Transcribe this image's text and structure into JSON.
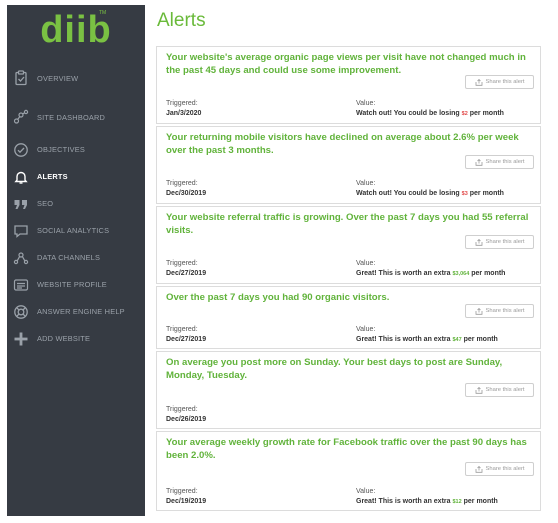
{
  "app": {
    "logo": "diib",
    "logo_mark": "TM"
  },
  "page": {
    "title": "Alerts"
  },
  "sidebar": {
    "items": [
      {
        "label": "OVERVIEW",
        "icon": "clipboard-check-icon",
        "active": false
      },
      {
        "label": "SITE DASHBOARD",
        "icon": "nodes-icon",
        "active": false
      },
      {
        "label": "OBJECTIVES",
        "icon": "check-circle-icon",
        "active": false
      },
      {
        "label": "ALERTS",
        "icon": "bell-icon",
        "active": true
      },
      {
        "label": "SEO",
        "icon": "quote-icon",
        "active": false
      },
      {
        "label": "SOCIAL ANALYTICS",
        "icon": "speech-bubble-icon",
        "active": false
      },
      {
        "label": "DATA CHANNELS",
        "icon": "channels-icon",
        "active": false
      },
      {
        "label": "WEBSITE PROFILE",
        "icon": "id-card-icon",
        "active": false
      },
      {
        "label": "ANSWER ENGINE HELP",
        "icon": "lifebuoy-icon",
        "active": false
      },
      {
        "label": "ADD WEBSITE",
        "icon": "plus-icon",
        "active": false
      }
    ]
  },
  "alerts": [
    {
      "message": "Your website's average organic page views per visit have not changed much in the past 45 days and could use some improvement.",
      "share_label": "Share this alert",
      "triggered_label": "Triggered:",
      "triggered": "Jan/3/2020",
      "value_label": "Value:",
      "value_prefix": "Watch out! You could be losing ",
      "value_amount": "$2",
      "value_suffix": " per month"
    },
    {
      "message": "Your returning mobile visitors have declined on average about 2.6% per week over the past 3 months.",
      "share_label": "Share this alert",
      "triggered_label": "Triggered:",
      "triggered": "Dec/30/2019",
      "value_label": "Value:",
      "value_prefix": "Watch out! You could be losing ",
      "value_amount": "$3",
      "value_suffix": " per month"
    },
    {
      "message": "Your website referral traffic is growing. Over the past 7 days you had 55 referral visits.",
      "share_label": "Share this alert",
      "triggered_label": "Triggered:",
      "triggered": "Dec/27/2019",
      "value_label": "Value:",
      "value_prefix": "Great! This is worth an extra ",
      "value_amount": "$3,064",
      "value_suffix": " per month"
    },
    {
      "message": "Over the past 7 days you had 90 organic visitors.",
      "share_label": "Share this alert",
      "triggered_label": "Triggered:",
      "triggered": "Dec/27/2019",
      "value_label": "Value:",
      "value_prefix": "Great! This is worth an extra ",
      "value_amount": "$47",
      "value_suffix": " per month"
    },
    {
      "message": "On average you post more on Sunday. Your best days to post are Sunday, Monday, Tuesday.",
      "share_label": "Share this alert",
      "triggered_label": "Triggered:",
      "triggered": "Dec/26/2019"
    },
    {
      "message": "Your average weekly growth rate for Facebook traffic over the past 90 days has been 2.0%.",
      "share_label": "Share this alert",
      "triggered_label": "Triggered:",
      "triggered": "Dec/19/2019",
      "value_label": "Value:",
      "value_prefix": "Great! This is worth an extra ",
      "value_amount": "$12",
      "value_suffix": " per month"
    }
  ],
  "colors": {
    "brand_green": "#61b33b",
    "sidebar_bg": "#363b43",
    "loss_red": "#e24a4a"
  }
}
